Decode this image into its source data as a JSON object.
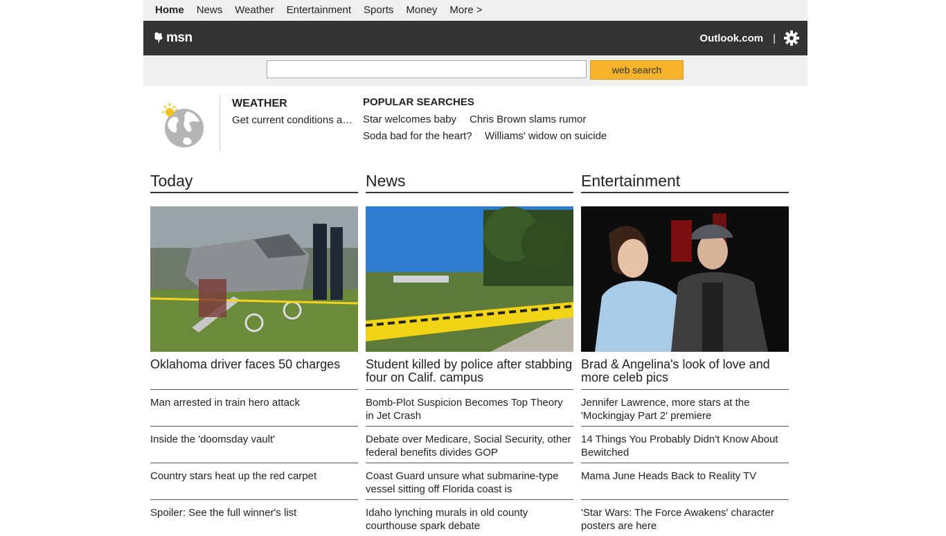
{
  "topnav": {
    "items": [
      "Home",
      "News",
      "Weather",
      "Entertainment",
      "Sports",
      "Money",
      "More >"
    ]
  },
  "header": {
    "logo_text": "msn",
    "outlook_label": "Outlook.com",
    "separator": "|",
    "settings_icon": "gear-icon"
  },
  "search": {
    "placeholder": "",
    "value": "",
    "button_label": "web search"
  },
  "weather": {
    "title": "WEATHER",
    "description": "Get current conditions and forecast",
    "icon": "globe-sun-icon"
  },
  "popular": {
    "title": "POPULAR SEARCHES",
    "links": [
      "Star welcomes baby",
      "Chris Brown slams rumor",
      "Soda bad for the heart?",
      "Williams' widow on suicide"
    ]
  },
  "columns": [
    {
      "heading": "Today",
      "image_desc": "crash scene",
      "lead": "Oklahoma driver faces 50 charges",
      "items": [
        "Man arrested in train hero attack",
        "Inside the 'doomsday vault'",
        "Country stars heat up the red carpet",
        "Spoiler: See the full winner's list"
      ]
    },
    {
      "heading": "News",
      "image_desc": "police tape",
      "lead": "Student killed by police after stabbing four on Calif. campus",
      "items": [
        "Bomb-Plot Suspicion Becomes Top Theory in Jet Crash",
        "Debate over Medicare, Social Security, other federal benefits divides GOP",
        "Coast Guard unsure what submarine-type vessel sitting off Florida coast is",
        "Idaho lynching murals in old county courthouse spark debate"
      ]
    },
    {
      "heading": "Entertainment",
      "image_desc": "celebrity couple",
      "lead": "Brad & Angelina's look of love and more celeb pics",
      "items": [
        "Jennifer Lawrence, more stars at the 'Mockingjay Part 2' premiere",
        "14 Things You Probably Didn't Know About Bewitched",
        "Mama June Heads Back to Reality TV",
        "'Star Wars: The Force Awakens' character posters are here"
      ]
    }
  ],
  "colors": {
    "header_bg": "#333333",
    "nav_bg": "#efefef",
    "search_button": "#f7b32b"
  }
}
